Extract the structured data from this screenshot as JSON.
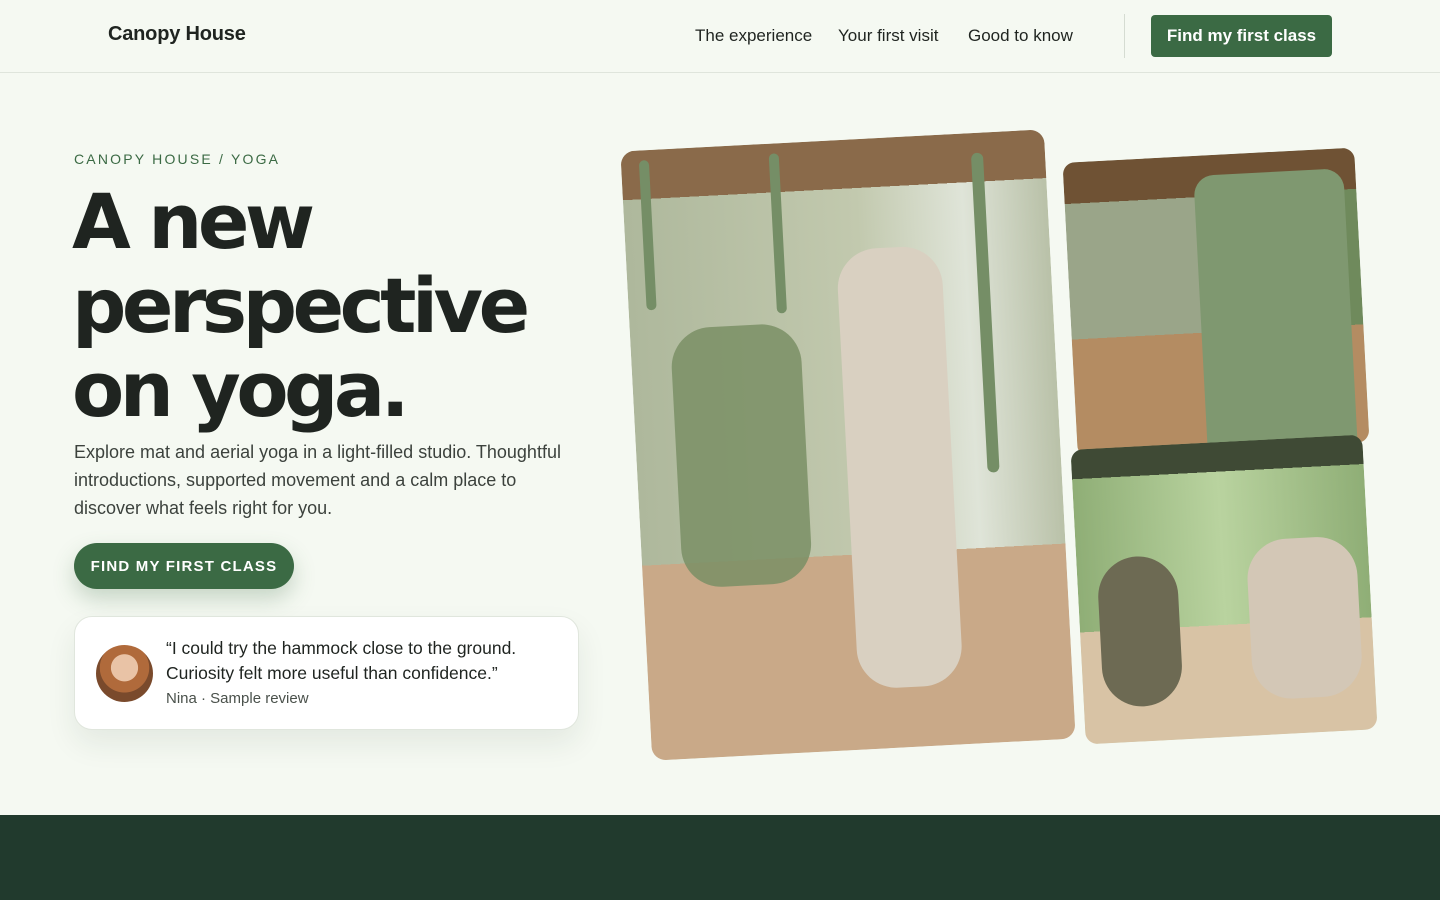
{
  "header": {
    "brand": "Canopy House",
    "nav": [
      "The experience",
      "Your first visit",
      "Good to know"
    ],
    "cta_label": "Find my first class"
  },
  "hero": {
    "eyebrow": "CANOPY HOUSE / YOGA",
    "headline_line1": "A new",
    "headline_line2": "perspective",
    "headline_line3": "on yoga.",
    "lead": "Explore mat and aerial yoga in a light-filled studio. Thoughtful introductions, supported movement and a calm place to discover what feels right for you.",
    "cta_label": "FIND MY FIRST CLASS"
  },
  "review": {
    "quote": "“I could try the hammock close to the ground. Curiosity felt more useful than confidence.”",
    "meta": "Nina · Sample review"
  },
  "colors": {
    "accent": "#3b6a44",
    "background": "#f5f9f2",
    "band": "#213a2d"
  }
}
